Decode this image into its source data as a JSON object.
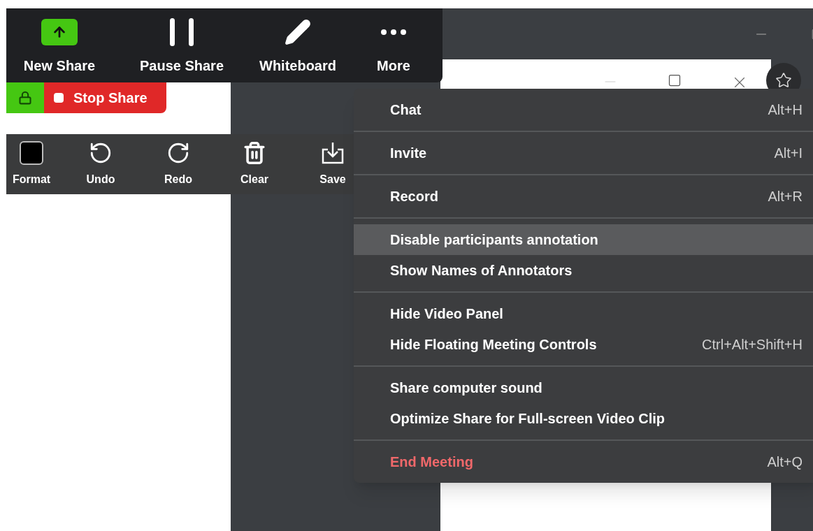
{
  "meeting_toolbar": {
    "buttons": [
      {
        "kind": "new-share",
        "label": "New Share"
      },
      {
        "kind": "pause",
        "label": "Pause Share"
      },
      {
        "kind": "whiteboard",
        "label": "Whiteboard"
      },
      {
        "kind": "more",
        "label": "More"
      }
    ]
  },
  "share_bar": {
    "stop_label": "Stop Share"
  },
  "annotation_toolbar": {
    "tools": [
      {
        "kind": "format",
        "label": "Format"
      },
      {
        "kind": "undo",
        "label": "Undo"
      },
      {
        "kind": "redo",
        "label": "Redo"
      },
      {
        "kind": "clear",
        "label": "Clear"
      },
      {
        "kind": "save",
        "label": "Save"
      }
    ]
  },
  "more_menu": {
    "sections": [
      {
        "items": [
          {
            "label": "Chat",
            "shortcut": "Alt+H",
            "selected": false,
            "kind": "normal"
          }
        ]
      },
      {
        "items": [
          {
            "label": "Invite",
            "shortcut": "Alt+I",
            "selected": false,
            "kind": "normal"
          }
        ]
      },
      {
        "items": [
          {
            "label": "Record",
            "shortcut": "Alt+R",
            "selected": false,
            "kind": "normal"
          }
        ]
      },
      {
        "items": [
          {
            "label": "Disable participants annotation",
            "selected": true,
            "kind": "normal"
          },
          {
            "label": "Show Names of Annotators",
            "selected": false,
            "kind": "normal"
          }
        ]
      },
      {
        "items": [
          {
            "label": "Hide Video Panel",
            "selected": false,
            "kind": "normal"
          },
          {
            "label": "Hide Floating Meeting Controls",
            "shortcut": "Ctrl+Alt+Shift+H",
            "selected": false,
            "kind": "normal"
          }
        ]
      },
      {
        "items": [
          {
            "label": "Share computer sound",
            "selected": false,
            "kind": "normal"
          },
          {
            "label": "Optimize Share for Full-screen Video Clip",
            "selected": false,
            "kind": "normal"
          }
        ]
      },
      {
        "items": [
          {
            "label": "End Meeting",
            "shortcut": "Alt+Q",
            "selected": false,
            "kind": "danger"
          }
        ]
      }
    ]
  }
}
